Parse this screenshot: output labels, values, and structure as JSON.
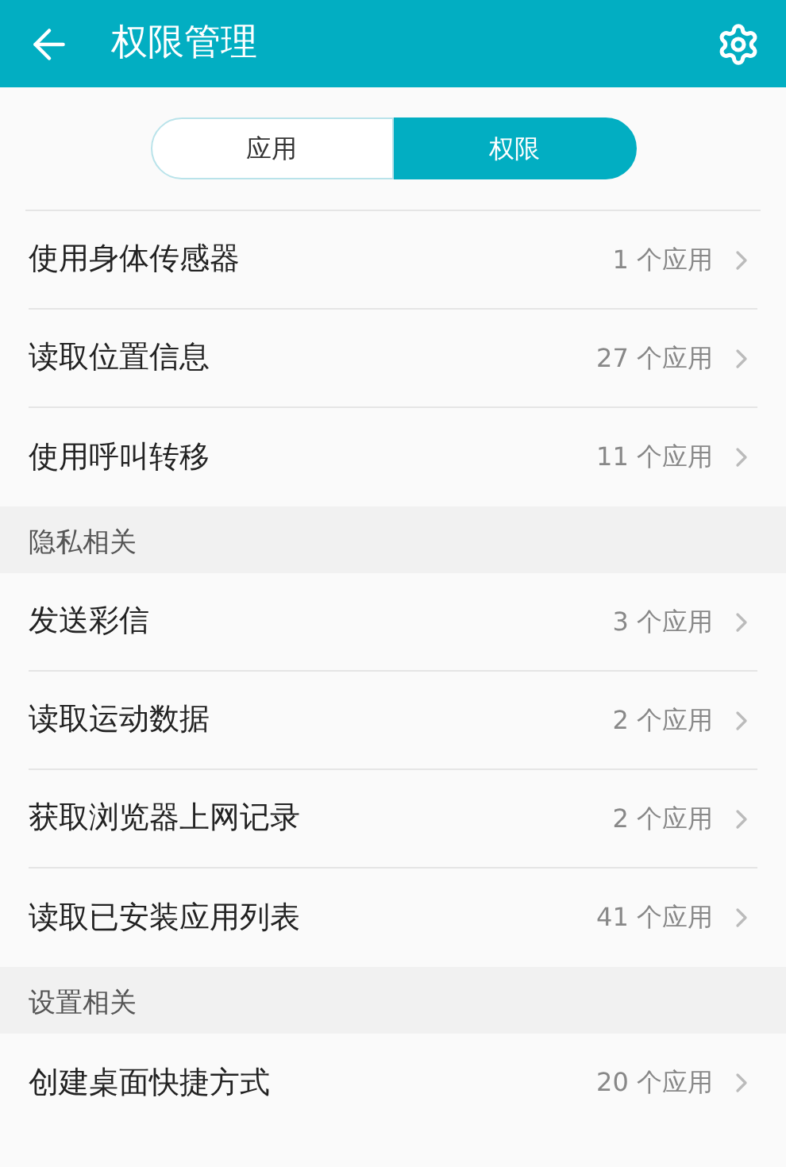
{
  "header": {
    "title": "权限管理"
  },
  "tabs": [
    {
      "label": "应用",
      "selected": false
    },
    {
      "label": "权限",
      "selected": true
    }
  ],
  "sections": [
    {
      "items": [
        {
          "label": "使用身体传感器",
          "count": "1 个应用"
        },
        {
          "label": "读取位置信息",
          "count": "27 个应用"
        },
        {
          "label": "使用呼叫转移",
          "count": "11 个应用"
        }
      ]
    },
    {
      "title": "隐私相关",
      "items": [
        {
          "label": "发送彩信",
          "count": "3 个应用"
        },
        {
          "label": "读取运动数据",
          "count": "2 个应用"
        },
        {
          "label": "获取浏览器上网记录",
          "count": "2 个应用"
        },
        {
          "label": "读取已安装应用列表",
          "count": "41 个应用"
        }
      ]
    },
    {
      "title": "设置相关",
      "items": [
        {
          "label": "创建桌面快捷方式",
          "count": "20 个应用"
        }
      ]
    }
  ]
}
